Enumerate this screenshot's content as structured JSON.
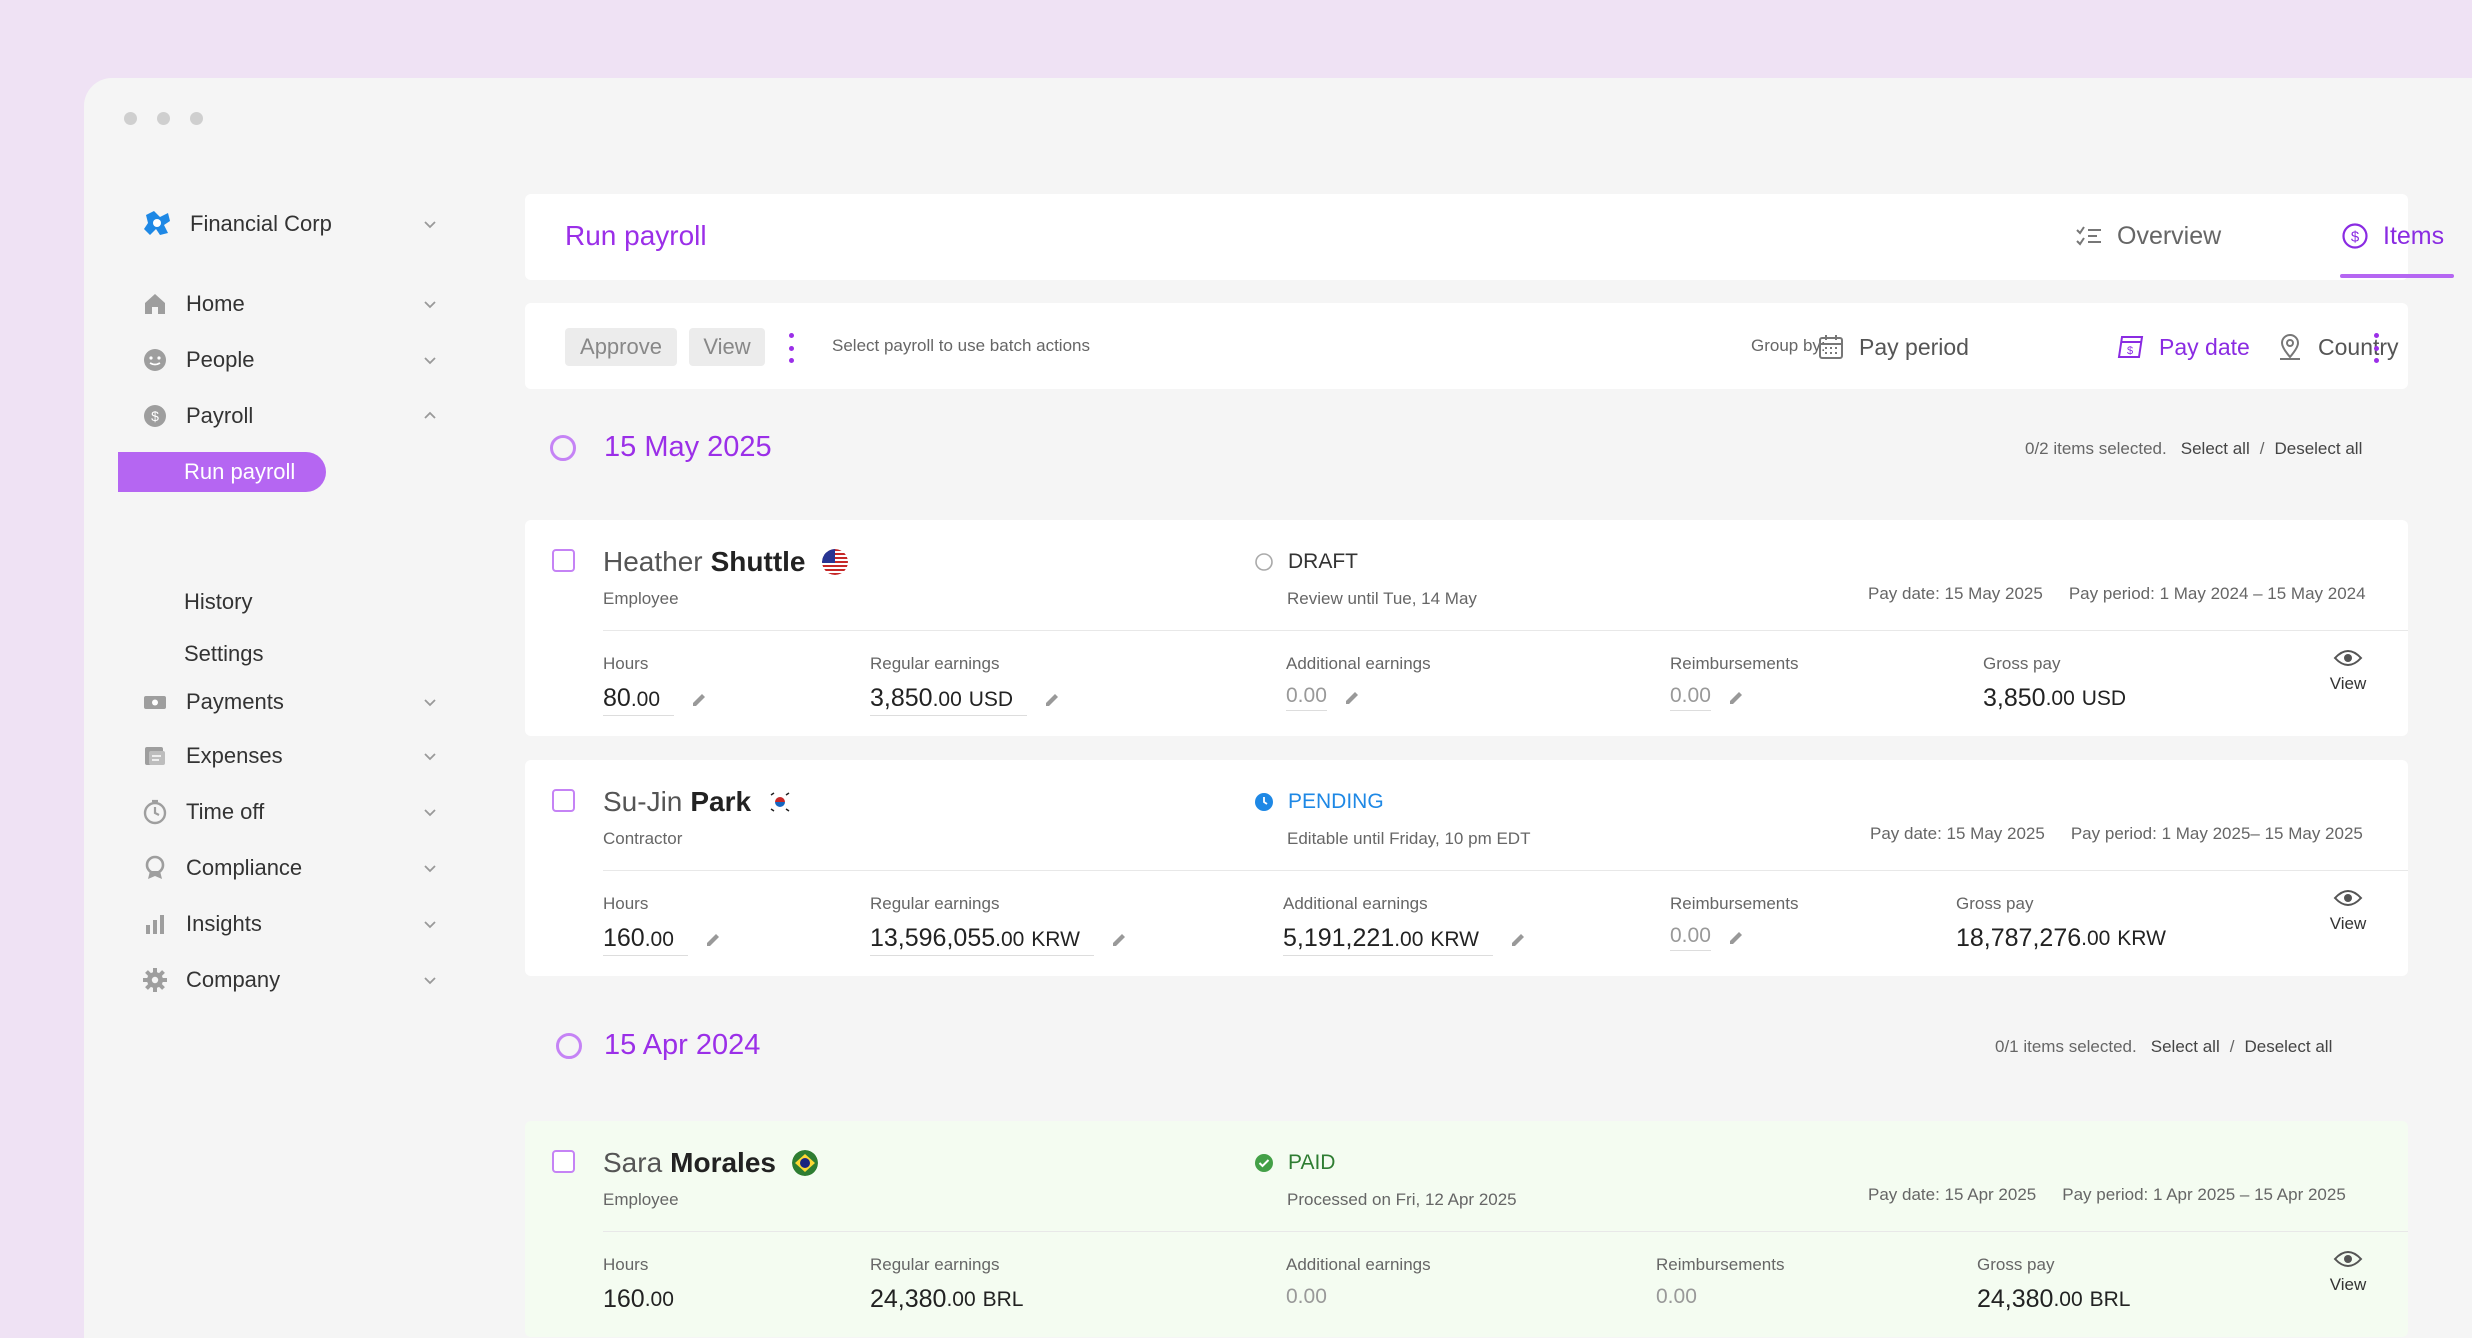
{
  "sidebar": {
    "org": "Financial Corp",
    "items": [
      {
        "label": "Home",
        "icon": "home-icon"
      },
      {
        "label": "People",
        "icon": "people-icon"
      },
      {
        "label": "Payroll",
        "icon": "payroll-icon"
      },
      {
        "label": "Payments",
        "icon": "payments-icon"
      },
      {
        "label": "Expenses",
        "icon": "expenses-icon"
      },
      {
        "label": "Time off",
        "icon": "time-off-icon"
      },
      {
        "label": "Compliance",
        "icon": "compliance-icon"
      },
      {
        "label": "Insights",
        "icon": "insights-icon"
      },
      {
        "label": "Company",
        "icon": "company-icon"
      }
    ],
    "payroll_sub": [
      "Run payroll",
      "History",
      "Settings"
    ]
  },
  "header": {
    "title": "Run payroll",
    "tabs": [
      "Overview",
      "Items"
    ]
  },
  "toolbar": {
    "approve": "Approve",
    "view": "View",
    "hint": "Select payroll to use batch actions",
    "group_by": "Group by:",
    "groups": [
      "Pay period",
      "Pay date",
      "Country"
    ]
  },
  "groups": [
    {
      "date": "15 May 2025",
      "selected": "0/2 items selected.",
      "select_all": "Select all",
      "sep": "/",
      "deselect_all": "Deselect all"
    },
    {
      "date": "15 Apr 2024",
      "selected": "0/1 items selected.",
      "select_all": "Select all",
      "sep": "/",
      "deselect_all": "Deselect all"
    }
  ],
  "labels": {
    "hours": "Hours",
    "regular": "Regular earnings",
    "additional": "Additional earnings",
    "reimb": "Reimbursements",
    "gross": "Gross pay",
    "view": "View"
  },
  "rows": [
    {
      "first": "Heather",
      "last": "Shuttle",
      "role": "Employee",
      "status": "DRAFT",
      "status_sub": "Review until Tue, 14 May",
      "pay_date": "Pay date:  15 May 2025",
      "pay_period": "Pay period:  1 May 2024 – 15 May 2024",
      "hours_main": "80",
      "hours_dec": ".00",
      "reg_main": "3,850",
      "reg_dec": ".00",
      "reg_cur": "USD",
      "add_val": "0.00",
      "reimb_val": "0.00",
      "gross_main": "3,850",
      "gross_dec": ".00",
      "gross_cur": "USD"
    },
    {
      "first": "Su-Jin",
      "last": "Park",
      "role": "Contractor",
      "status": "PENDING",
      "status_sub": "Editable until Friday, 10 pm EDT",
      "pay_date": "Pay date: 15 May 2025",
      "pay_period": "Pay period:  1 May 2025– 15 May 2025",
      "hours_main": "160",
      "hours_dec": ".00",
      "reg_main": "13,596,055",
      "reg_dec": ".00",
      "reg_cur": "KRW",
      "add_main": "5,191,221",
      "add_dec": ".00",
      "add_cur": "KRW",
      "reimb_val": "0.00",
      "gross_main": "18,787,276",
      "gross_dec": ".00",
      "gross_cur": "KRW"
    },
    {
      "first": "Sara",
      "last": "Morales",
      "role": "Employee",
      "status": "PAID",
      "status_sub": "Processed on Fri, 12 Apr 2025",
      "pay_date": "Pay date:  15 Apr 2025",
      "pay_period": "Pay period:  1 Apr 2025 – 15 Apr 2025",
      "hours_main": "160",
      "hours_dec": ".00",
      "reg_main": "24,380",
      "reg_dec": ".00",
      "reg_cur": "BRL",
      "add_val": "0.00",
      "reimb_val": "0.00",
      "gross_main": "24,380",
      "gross_dec": ".00",
      "gross_cur": "BRL"
    }
  ],
  "colors": {
    "accent": "#9b2fe8",
    "pending": "#1e88e5",
    "paid": "#43a047"
  }
}
